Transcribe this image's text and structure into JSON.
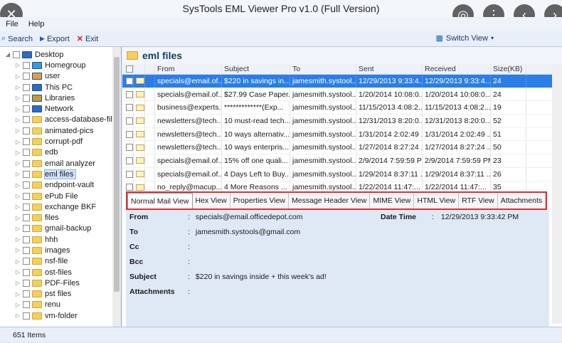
{
  "window": {
    "title": "SysTools EML Viewer Pro v1.0 (Full Version)"
  },
  "menu": {
    "file": "File",
    "help": "Help"
  },
  "toolbar": {
    "search": "Search",
    "export": "Export",
    "exit": "Exit",
    "switch_view": "Switch View"
  },
  "tree": {
    "items": [
      {
        "label": "Desktop",
        "level": 0,
        "icon": "desktop-icon"
      },
      {
        "label": "Homegroup",
        "level": 1,
        "icon": "homegroup-icon"
      },
      {
        "label": "user",
        "level": 1,
        "icon": "user-icon"
      },
      {
        "label": "This PC",
        "level": 1,
        "icon": "computer-icon"
      },
      {
        "label": "Libraries",
        "level": 1,
        "icon": "library-icon"
      },
      {
        "label": "Network",
        "level": 1,
        "icon": "network-icon"
      },
      {
        "label": "access-database-file",
        "level": 1,
        "icon": "folder-icon"
      },
      {
        "label": "animated-pics",
        "level": 1,
        "icon": "folder-icon"
      },
      {
        "label": "corrupt-pdf",
        "level": 1,
        "icon": "folder-icon"
      },
      {
        "label": "edb",
        "level": 1,
        "icon": "folder-icon"
      },
      {
        "label": "email analyzer",
        "level": 1,
        "icon": "folder-icon"
      },
      {
        "label": "eml files",
        "level": 1,
        "icon": "folder-icon"
      },
      {
        "label": "endpoint-vault",
        "level": 1,
        "icon": "folder-icon"
      },
      {
        "label": "ePub File",
        "level": 1,
        "icon": "folder-icon"
      },
      {
        "label": "exchange BKF",
        "level": 1,
        "icon": "folder-icon"
      },
      {
        "label": "files",
        "level": 1,
        "icon": "folder-icon"
      },
      {
        "label": "gmail-backup",
        "level": 1,
        "icon": "folder-icon"
      },
      {
        "label": "hhh",
        "level": 1,
        "icon": "folder-icon"
      },
      {
        "label": "images",
        "level": 1,
        "icon": "folder-icon"
      },
      {
        "label": "nsf-file",
        "level": 1,
        "icon": "folder-icon"
      },
      {
        "label": "ost-files",
        "level": 1,
        "icon": "folder-icon"
      },
      {
        "label": "PDF-Files",
        "level": 1,
        "icon": "folder-icon"
      },
      {
        "label": "pst files",
        "level": 1,
        "icon": "folder-icon"
      },
      {
        "label": "renu",
        "level": 1,
        "icon": "folder-icon"
      },
      {
        "label": "vm-folder",
        "level": 1,
        "icon": "folder-icon"
      }
    ],
    "selected_index": 11
  },
  "panel": {
    "title": "eml files"
  },
  "grid": {
    "columns": [
      "From",
      "Subject",
      "To",
      "Sent",
      "Received",
      "Size(KB)"
    ],
    "rows": [
      [
        "specials@email.of...",
        "$220 in savings in...",
        "jamesmith.systool...",
        "12/29/2013 9:33:4...",
        "12/29/2013 9:33:4...",
        "24"
      ],
      [
        "specials@email.of...",
        "$27.99 Case Paper...",
        "jamesmith.systool...",
        "1/20/2014 10:08:0...",
        "1/20/2014 10:08:0...",
        "24"
      ],
      [
        "business@experts...",
        "*************(Exp...",
        "jamesmith.systool...",
        "11/15/2013 4:08:2...",
        "11/15/2013 4:08:2...",
        "19"
      ],
      [
        "newsletters@tech...",
        "10 must-read tech...",
        "jamesmith.systool...",
        "12/31/2013 8:20:0...",
        "12/31/2013 8:20:0...",
        "52"
      ],
      [
        "newsletters@tech...",
        "10 ways alternativ...",
        "jamesmith.systool...",
        "1/31/2014 2:02:49 ...",
        "1/31/2014 2:02:49 ...",
        "51"
      ],
      [
        "newsletters@tech...",
        "10 ways enterpris...",
        "jamesmith.systool...",
        "1/27/2014 8:27:24 ...",
        "1/27/2014 8:27:24 ...",
        "50"
      ],
      [
        "specials@email.of...",
        "15% off one quali...",
        "jamesmith.systool...",
        "2/9/2014 7:59:59 PM",
        "2/9/2014 7:59:59 PM",
        "23"
      ],
      [
        "specials@email.of...",
        "4 Days Left to Buy...",
        "jamesmith.systool...",
        "1/29/2014 8:37:11 ...",
        "1/29/2014 8:37:11 ...",
        "26"
      ],
      [
        "no_reply@macup...",
        "4 More Reasons ...",
        "jamesmith.systool...",
        "1/22/2014 11:47:...",
        "1/22/2014 11:47:...",
        "35"
      ]
    ],
    "selected_row": 0
  },
  "tabs": [
    "Normal Mail View",
    "Hex View",
    "Properties View",
    "Message Header View",
    "MIME View",
    "HTML View",
    "RTF View",
    "Attachments"
  ],
  "active_tab": 0,
  "detail": {
    "from_label": "From",
    "from": "specials@email.officedepot.com",
    "datetime_label": "Date Time",
    "datetime": "12/29/2013 9:33:42 PM",
    "to_label": "To",
    "to": "jamesmith.systools@gmail.com",
    "cc_label": "Cc",
    "cc": "",
    "bcc_label": "Bcc",
    "bcc": "",
    "subject_label": "Subject",
    "subject": "$220 in savings inside + this week's ad!",
    "attachments_label": "Attachments",
    "attachments": "",
    "separator": ":"
  },
  "status": {
    "count": "651 Items"
  },
  "colors": {
    "accent": "#2b7ee6",
    "tab_highlight": "#e03030",
    "folder": "#f3cf5e"
  }
}
